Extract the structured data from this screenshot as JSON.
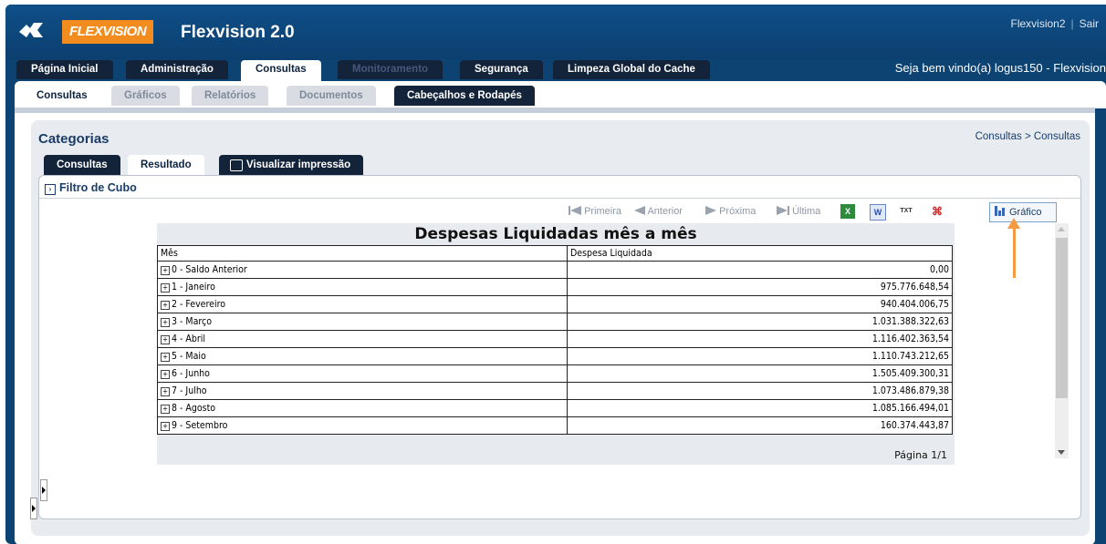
{
  "header": {
    "brand": "FLEXVISION",
    "app_title": "Flexvision 2.0",
    "user_link": "Flexvision2",
    "logout_link": "Sair",
    "welcome": "Seja bem vindo(a) logus150 - Flexvision"
  },
  "main_tabs": [
    {
      "label": "Página Inicial",
      "state": "normal"
    },
    {
      "label": "Administração",
      "state": "normal"
    },
    {
      "label": "Consultas",
      "state": "active"
    },
    {
      "label": "Monitoramento",
      "state": "disabled"
    },
    {
      "label": "Segurança",
      "state": "normal"
    },
    {
      "label": "Limpeza Global do Cache",
      "state": "normal"
    }
  ],
  "sub_tabs": [
    {
      "label": "Consultas",
      "state": "active"
    },
    {
      "label": "Gráficos",
      "state": "normal"
    },
    {
      "label": "Relatórios",
      "state": "normal"
    },
    {
      "label": "Documentos",
      "state": "normal"
    },
    {
      "label": "Cabeçalhos e Rodapés",
      "state": "dark"
    }
  ],
  "panel": {
    "title": "Categorias",
    "breadcrumb": "Consultas > Consultas",
    "tabs": [
      "Consultas",
      "Resultado",
      "Visualizar impressão"
    ],
    "filter_label": "Filtro de Cubo"
  },
  "toolbar": {
    "first": "Primeira",
    "prev": "Anterior",
    "next": "Próxima",
    "last": "Última",
    "chart_button": "Gráfico",
    "icons": [
      "excel-icon",
      "word-icon",
      "txt-icon",
      "pdf-icon",
      "chart-icon"
    ]
  },
  "report": {
    "title": "Despesas Liquidadas mês a mês",
    "columns": [
      "Mês",
      "Despesa Liquidada"
    ],
    "rows": [
      {
        "mes": "0 - Saldo Anterior",
        "valor": "0,00"
      },
      {
        "mes": "1 - Janeiro",
        "valor": "975.776.648,54"
      },
      {
        "mes": "2 - Fevereiro",
        "valor": "940.404.006,75"
      },
      {
        "mes": "3 - Março",
        "valor": "1.031.388.322,63"
      },
      {
        "mes": "4 - Abril",
        "valor": "1.116.402.363,54"
      },
      {
        "mes": "5 - Maio",
        "valor": "1.110.743.212,65"
      },
      {
        "mes": "6 - Junho",
        "valor": "1.505.409.300,31"
      },
      {
        "mes": "7 - Julho",
        "valor": "1.073.486.879,38"
      },
      {
        "mes": "8 - Agosto",
        "valor": "1.085.166.494,01"
      },
      {
        "mes": "9 - Setembro",
        "valor": "160.374.443,87"
      }
    ],
    "page": "Página 1/1"
  },
  "colors": {
    "header_bg": "#0d4372",
    "brand_orange": "#f28c1f",
    "arrow": "#f39a42",
    "tab_dark": "#13233a"
  }
}
